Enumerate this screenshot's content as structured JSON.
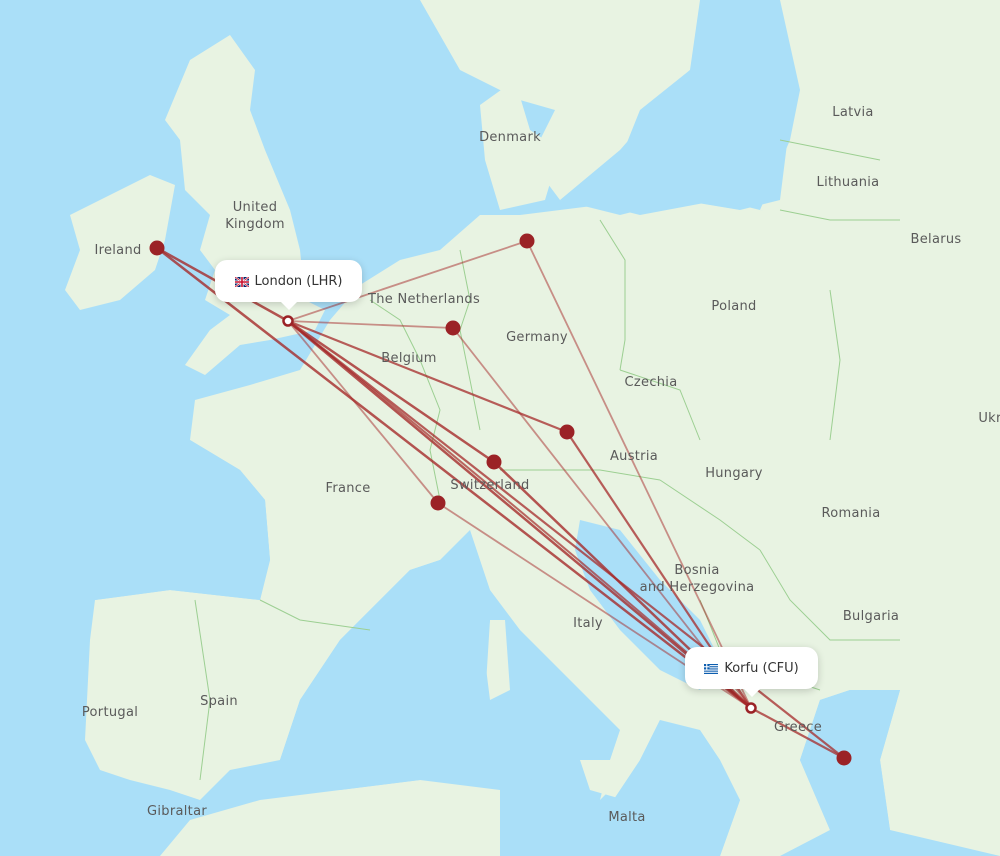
{
  "map": {
    "colors": {
      "water": "#aadff8",
      "land": "#e8f3e2",
      "border": "#9ccf92",
      "route": "#a52a2a",
      "marker": "#9b2226",
      "label": "#5a5a5a"
    },
    "origin": {
      "city": "London",
      "code": "LHR",
      "label": "London (LHR)",
      "flag": "uk-flag-icon"
    },
    "destination": {
      "city": "Korfu",
      "code": "CFU",
      "label": "Korfu (CFU)",
      "flag": "greece-flag-icon"
    },
    "country_labels": [
      {
        "name": "Ireland"
      },
      {
        "name": "United"
      },
      {
        "name": "Kingdom"
      },
      {
        "name": "Denmark"
      },
      {
        "name": "The Netherlands"
      },
      {
        "name": "Belgium"
      },
      {
        "name": "Germany"
      },
      {
        "name": "Poland"
      },
      {
        "name": "Latvia"
      },
      {
        "name": "Lithuania"
      },
      {
        "name": "Belarus"
      },
      {
        "name": "Czechia"
      },
      {
        "name": "Austria"
      },
      {
        "name": "Hungary"
      },
      {
        "name": "Romania"
      },
      {
        "name": "Ukr"
      },
      {
        "name": "France"
      },
      {
        "name": "Switzerland"
      },
      {
        "name": "Bosnia"
      },
      {
        "name": "and Herzegovina"
      },
      {
        "name": "Italy"
      },
      {
        "name": "Bulgaria"
      },
      {
        "name": "Greece"
      },
      {
        "name": "Spain"
      },
      {
        "name": "Portugal"
      },
      {
        "name": "Gibraltar"
      },
      {
        "name": "Malta"
      }
    ],
    "stopover_airports": [
      {
        "name": "dublin-airport"
      },
      {
        "name": "hamburg-airport"
      },
      {
        "name": "dusseldorf-airport"
      },
      {
        "name": "munich-airport"
      },
      {
        "name": "zurich-airport"
      },
      {
        "name": "geneva-airport"
      },
      {
        "name": "athens-airport"
      }
    ]
  }
}
